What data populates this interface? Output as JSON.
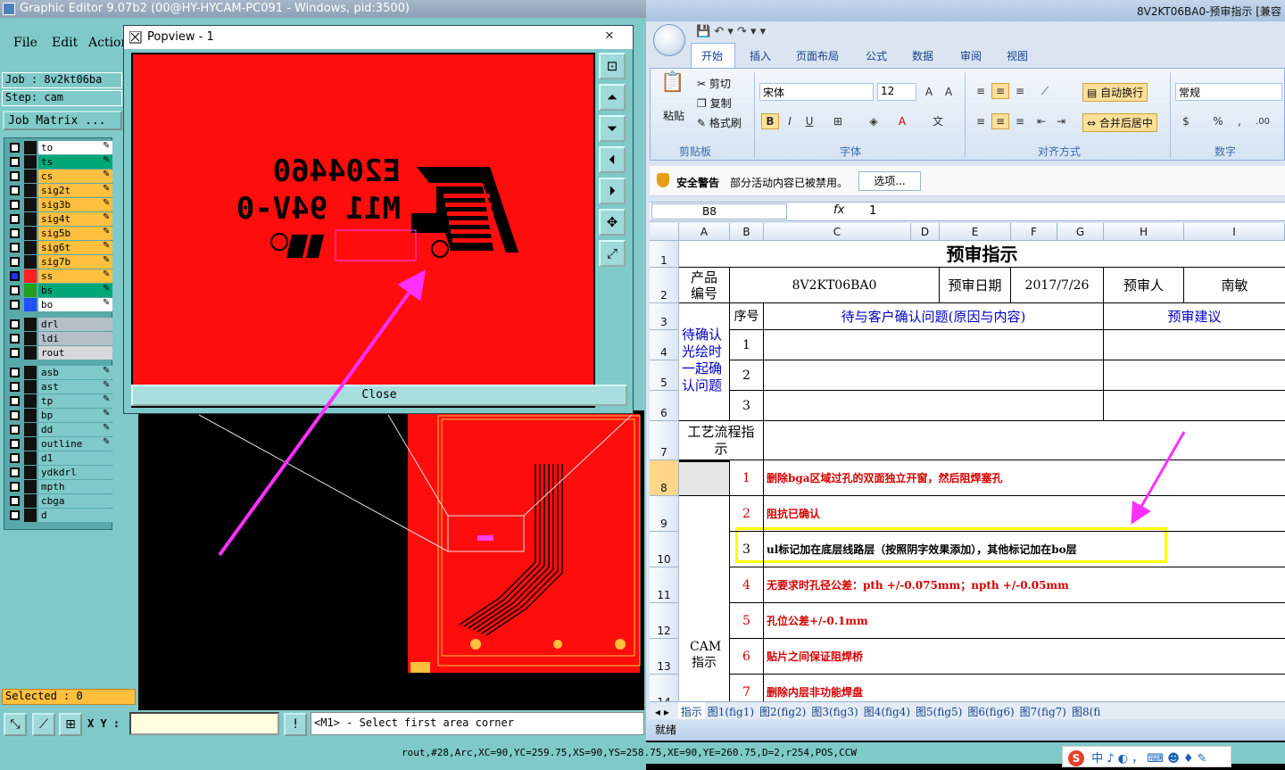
{
  "cam": {
    "title": "Graphic Editor 9.07b2 (00@HY-HYCAM-PC091 - Windows, pid:3500)",
    "menus": [
      "File",
      "Edit",
      "Action"
    ],
    "job": "Job : 8v2kt06ba",
    "step": "Step: cam",
    "job_matrix": "Job Matrix ...",
    "layers": [
      {
        "name": "to",
        "color": "#ffffff"
      },
      {
        "name": "ts",
        "color": "#00a878"
      },
      {
        "name": "cs",
        "color": "#ffbf3f"
      },
      {
        "name": "sig2t",
        "color": "#ffbf3f"
      },
      {
        "name": "sig3b",
        "color": "#ffbf3f"
      },
      {
        "name": "sig4t",
        "color": "#ffbf3f"
      },
      {
        "name": "sig5b",
        "color": "#ffbf3f"
      },
      {
        "name": "sig6t",
        "color": "#ffbf3f"
      },
      {
        "name": "sig7b",
        "color": "#ffbf3f"
      },
      {
        "name": "ss",
        "color": "#ffbf3f"
      },
      {
        "name": "bs",
        "color": "#00a878"
      },
      {
        "name": "bo",
        "color": "#ffffff"
      },
      {
        "name": "drl",
        "color": "#b5c0c8"
      },
      {
        "name": "ldi",
        "color": "#b5c0c8"
      },
      {
        "name": "rout",
        "color": "#d8d8d8"
      },
      {
        "name": "asb",
        "color": "#7fc9c9"
      },
      {
        "name": "ast",
        "color": "#7fc9c9"
      },
      {
        "name": "tp",
        "color": "#7fc9c9"
      },
      {
        "name": "bp",
        "color": "#7fc9c9"
      },
      {
        "name": "dd",
        "color": "#7fc9c9"
      },
      {
        "name": "outline",
        "color": "#7fc9c9"
      },
      {
        "name": "d1",
        "color": "#7fc9c9"
      },
      {
        "name": "ydkdrl",
        "color": "#7fc9c9"
      },
      {
        "name": "mpth",
        "color": "#7fc9c9"
      },
      {
        "name": "cbga",
        "color": "#7fc9c9"
      },
      {
        "name": "d",
        "color": "#7fc9c9"
      }
    ],
    "selected": "Selected : 0",
    "xy_label": "X Y :",
    "message": "<M1> - Select first area corner",
    "status_line": "rout,#28,Arc,XC=90,YC=259.75,XS=90,YS=258.75,XE=90,YE=260.75,D=2,r254,POS,CCW",
    "popview": {
      "title": "Popview - 1",
      "close_label": "Close",
      "mark_line1": "E204460",
      "mark_line2": "M11 94V-0"
    }
  },
  "excel": {
    "title": "8V2KT06BA0-预审指示  [兼容",
    "tabs": [
      "开始",
      "插入",
      "页面布局",
      "公式",
      "数据",
      "审阅",
      "视图"
    ],
    "clipboard": {
      "paste": "粘贴",
      "cut": "剪切",
      "copy": "复制",
      "format_painter": "格式刷",
      "group": "剪贴板"
    },
    "font": {
      "name": "宋体",
      "size": "12",
      "group": "字体"
    },
    "alignment": {
      "wrap": "自动换行",
      "merge": "合并后居中",
      "group": "对齐方式"
    },
    "number": {
      "format": "常规",
      "group": "数字"
    },
    "security": {
      "title": "安全警告",
      "text": "部分活动内容已被禁用。",
      "button": "选项..."
    },
    "name_box": "B8",
    "formula_value": "1",
    "columns": [
      "A",
      "B",
      "C",
      "D",
      "E",
      "F",
      "G",
      "H",
      "I"
    ],
    "rows": [
      "1",
      "2",
      "3",
      "4",
      "5",
      "6",
      "7",
      "8",
      "9",
      "10",
      "11",
      "12",
      "13",
      "14"
    ],
    "sheet": {
      "title": "预审指示",
      "product_label": "产品编号",
      "product_no": "8V2KT06BA0",
      "date_label": "预审日期",
      "date": "2017/7/26",
      "reviewer_label": "预审人",
      "reviewer": "南敏",
      "confirm_label": "待确认光绘时一起确认问题",
      "seq_label": "序号",
      "issue_header": "待与客户确认问题(原因与内容)",
      "suggestion_header": "预审建议",
      "seq": [
        "1",
        "2",
        "3"
      ],
      "process_label": "工艺流程指示",
      "cam_label": "CAM指示",
      "cam_items": [
        {
          "no": "1",
          "text": "删除bga区域过孔的双面独立开窗，然后阻焊塞孔",
          "color": "#d40000"
        },
        {
          "no": "2",
          "text": "阻抗已确认",
          "color": "#d40000"
        },
        {
          "no": "3",
          "text": "ul标记加在底层线路层（按照阴字效果添加），其他标记加在bo层",
          "color": "#000000"
        },
        {
          "no": "4",
          "text": "无要求时孔径公差：pth +/-0.075mm；npth +/-0.05mm",
          "color": "#d40000"
        },
        {
          "no": "5",
          "text": "孔位公差+/-0.1mm",
          "color": "#d40000"
        },
        {
          "no": "6",
          "text": "贴片之间保证阻焊桥",
          "color": "#d40000"
        },
        {
          "no": "7",
          "text": "删除内层非功能焊盘",
          "color": "#d40000"
        }
      ]
    },
    "sheet_tabs": [
      "指示",
      "图1(fig1)",
      "图2(fig2)",
      "图3(fig3)",
      "图4(fig4)",
      "图5(fig5)",
      "图6(fig6)",
      "图7(fig7)",
      "图8(fi"
    ],
    "status": "就绪"
  },
  "ime": {
    "text": "中 ♪ ◐ ， ⌨ ☻ ♦ ✎"
  }
}
